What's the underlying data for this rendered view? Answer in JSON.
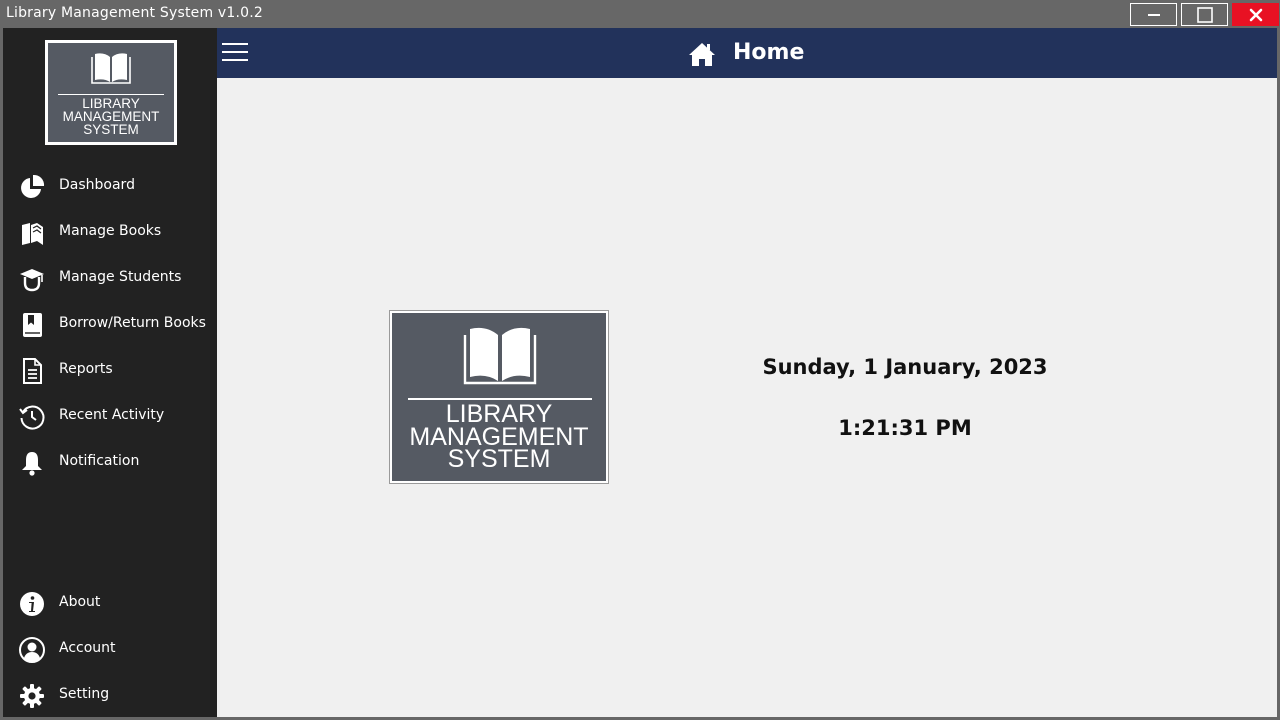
{
  "window": {
    "title": "Library Management System v1.0.2",
    "controls": [
      "minimize",
      "maximize",
      "close"
    ],
    "close_color": "#e81123",
    "frame_color": "#676767"
  },
  "brand": {
    "line1": "LIBRARY",
    "line2": "MANAGEMENT",
    "line3": "SYSTEM"
  },
  "sidebar": {
    "background": "#222222",
    "items": [
      {
        "label": "Dashboard",
        "icon": "pie-chart-icon"
      },
      {
        "label": "Manage Books",
        "icon": "books-icon"
      },
      {
        "label": "Manage Students",
        "icon": "graduation-cap-icon"
      },
      {
        "label": "Borrow/Return Books",
        "icon": "book-bookmark-icon"
      },
      {
        "label": "Reports",
        "icon": "document-icon"
      },
      {
        "label": "Recent Activity",
        "icon": "history-icon"
      },
      {
        "label": "Notification",
        "icon": "bell-icon"
      }
    ],
    "bottom_items": [
      {
        "label": "About",
        "icon": "info-icon"
      },
      {
        "label": "Account",
        "icon": "user-icon"
      },
      {
        "label": "Setting",
        "icon": "gear-icon"
      }
    ]
  },
  "header": {
    "title": "Home",
    "icon": "home-icon",
    "background": "#22325b"
  },
  "main": {
    "date": "Sunday, 1 January, 2023",
    "time": "1:21:31 PM"
  }
}
